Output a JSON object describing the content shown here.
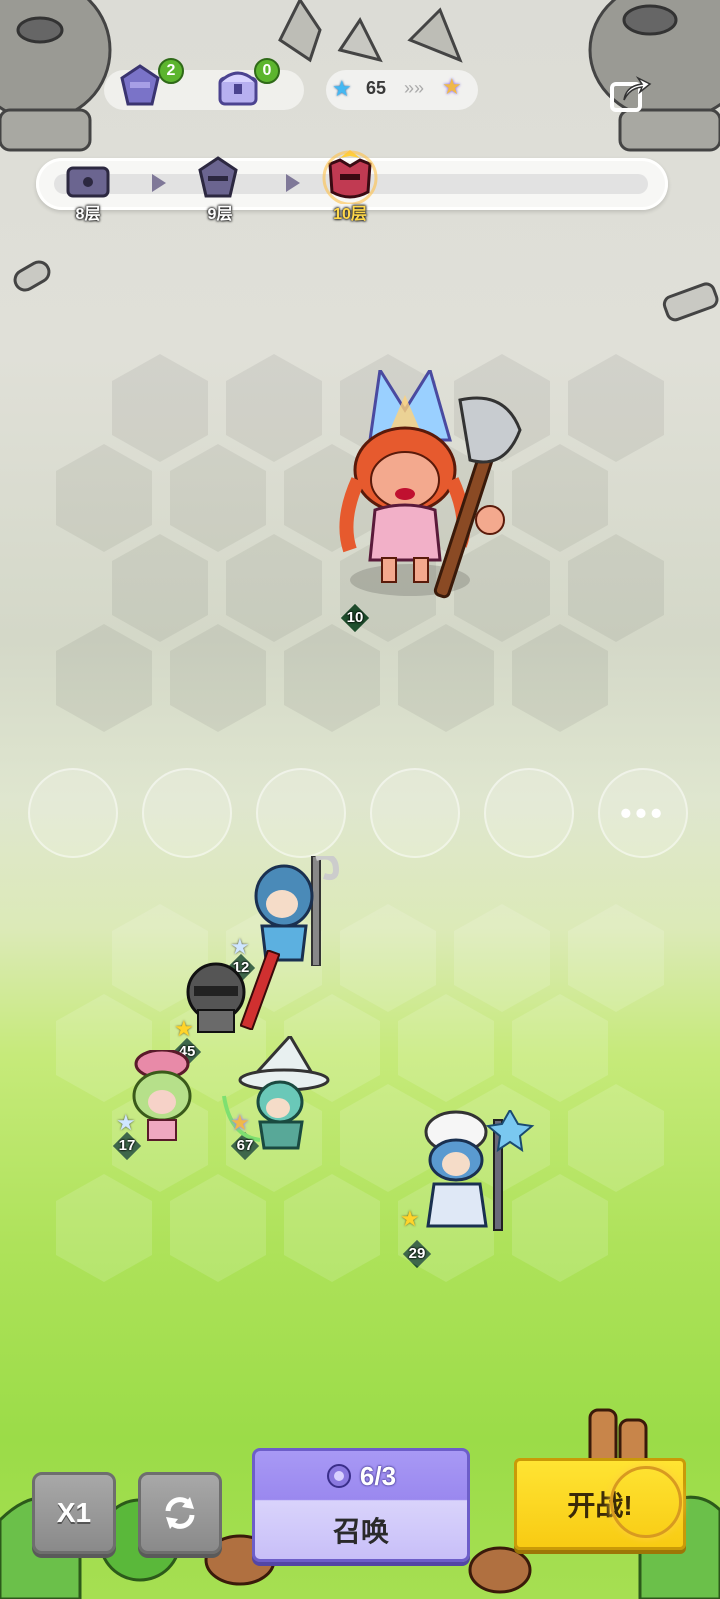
{
  "resources": {
    "item1": {
      "icon": "blue-stone-icon",
      "count": "2"
    },
    "item2": {
      "icon": "purple-chest-icon",
      "count": "0"
    },
    "stars": {
      "icon": "blue-star-icon",
      "count": "65",
      "target_icon": "rainbow-star-icon"
    }
  },
  "progress": {
    "floors": [
      {
        "label": "8层",
        "icon": "chest-floor-icon"
      },
      {
        "label": "9层",
        "icon": "stone-floor-icon"
      },
      {
        "label": "10层",
        "icon": "boss-floor-icon",
        "active": true
      }
    ]
  },
  "board": {
    "boss": {
      "name": "axe-boss",
      "level": "10"
    },
    "units": [
      {
        "name": "blue-hair-mage",
        "level": "12",
        "star": "silver"
      },
      {
        "name": "knight",
        "level": "45",
        "star": "gold"
      },
      {
        "name": "pink-healer",
        "level": "17",
        "star": "silver"
      },
      {
        "name": "white-hat-wizard",
        "level": "67",
        "star": "rainbow"
      },
      {
        "name": "ice-mage",
        "level": "29",
        "star": "gold"
      }
    ],
    "bench_more": "•••"
  },
  "controls": {
    "speed_label": "X1",
    "refresh_icon": "refresh-icon",
    "summon": {
      "cost": "6/3",
      "label": "召唤",
      "icon": "purple-orb-icon"
    },
    "fight_label": "开战!"
  },
  "colors": {
    "summon": "#9a88ef",
    "fight": "#f8cb13",
    "active_floor": "#ffd84a"
  }
}
